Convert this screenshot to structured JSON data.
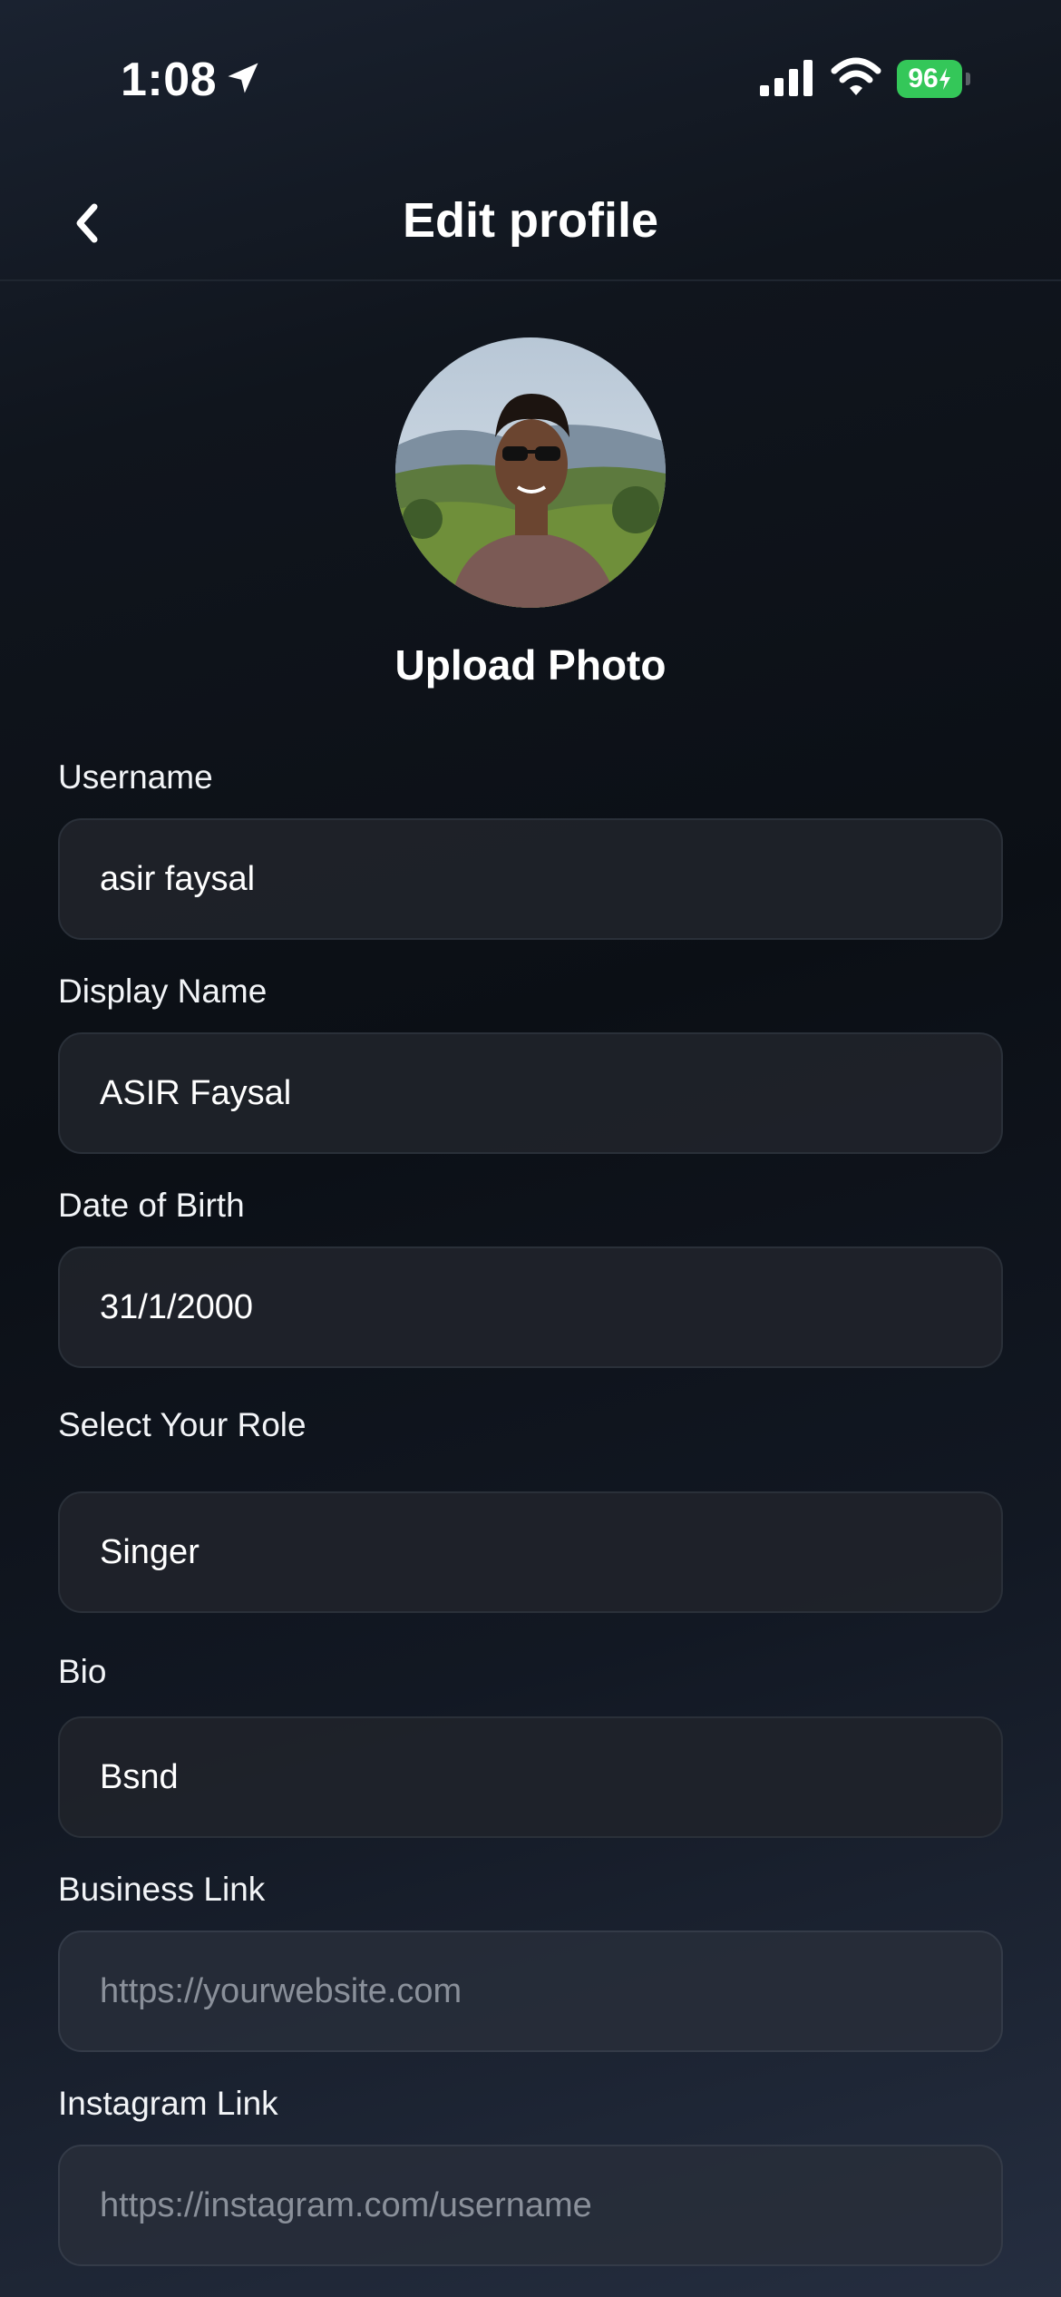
{
  "status_bar": {
    "time": "1:08",
    "battery": "96"
  },
  "nav": {
    "title": "Edit profile"
  },
  "avatar": {
    "upload_label": "Upload Photo"
  },
  "form": {
    "fields": [
      {
        "label": "Username",
        "value": "asir faysal"
      },
      {
        "label": "Display Name",
        "value": "ASIR Faysal"
      },
      {
        "label": "Date of Birth",
        "value": "31/1/2000"
      },
      {
        "label": "Select Your Role",
        "value": "Singer"
      },
      {
        "label": "Bio",
        "value": "Bsnd"
      },
      {
        "label": "Business Link",
        "placeholder": "https://yourwebsite.com"
      },
      {
        "label": "Instagram Link",
        "placeholder": "https://instagram.com/username"
      }
    ]
  },
  "colors": {
    "battery": "#34c759",
    "field_bg": "#1f232a",
    "placeholder": "#8a909a"
  }
}
